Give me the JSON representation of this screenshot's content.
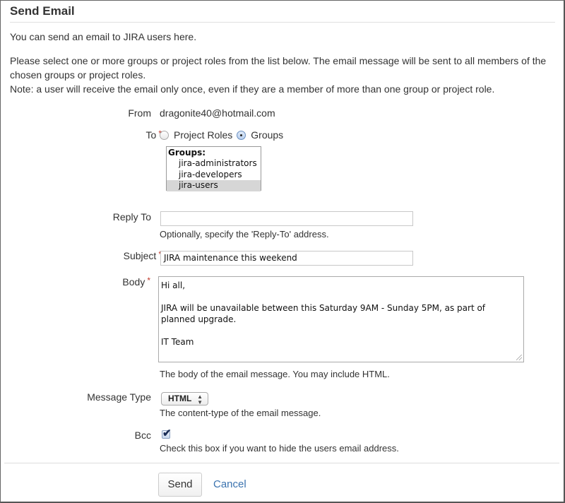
{
  "page": {
    "title": "Send Email",
    "intro": "You can send an email to JIRA users here.",
    "instructions": "Please select one or more groups or project roles from the list below. The email message will be sent to all members of the chosen groups or project roles.",
    "note": "Note: a user will receive the email only once, even if they are a member of more than one group or project role."
  },
  "form": {
    "from": {
      "label": "From",
      "value": "dragonite40@hotmail.com"
    },
    "to": {
      "label": "To",
      "required_marker": "*",
      "options": [
        {
          "label": "Project Roles",
          "selected": false
        },
        {
          "label": "Groups",
          "selected": true
        }
      ],
      "list": {
        "header": "Groups:",
        "items": [
          {
            "label": "jira-administrators",
            "selected": false
          },
          {
            "label": "jira-developers",
            "selected": false
          },
          {
            "label": "jira-users",
            "selected": true
          }
        ]
      }
    },
    "reply_to": {
      "label": "Reply To",
      "value": "",
      "help": "Optionally, specify the 'Reply-To' address."
    },
    "subject": {
      "label": "Subject",
      "required_marker": "*",
      "value": "JIRA maintenance this weekend"
    },
    "body": {
      "label": "Body",
      "required_marker": "*",
      "value": "Hi all,\n\nJIRA will be unavailable between this Saturday 9AM - Sunday 5PM, as part of planned upgrade.\n\nIT Team",
      "help": "The body of the email message. You may include HTML."
    },
    "message_type": {
      "label": "Message Type",
      "value": "HTML",
      "help": "The content-type of the email message."
    },
    "bcc": {
      "label": "Bcc",
      "checked": true,
      "help": "Check this box if you want to hide the users email address."
    }
  },
  "actions": {
    "send_label": "Send",
    "cancel_label": "Cancel"
  },
  "colors": {
    "required": "#c0392b",
    "link": "#3b73af",
    "list_selected": "#d6d6d6"
  }
}
